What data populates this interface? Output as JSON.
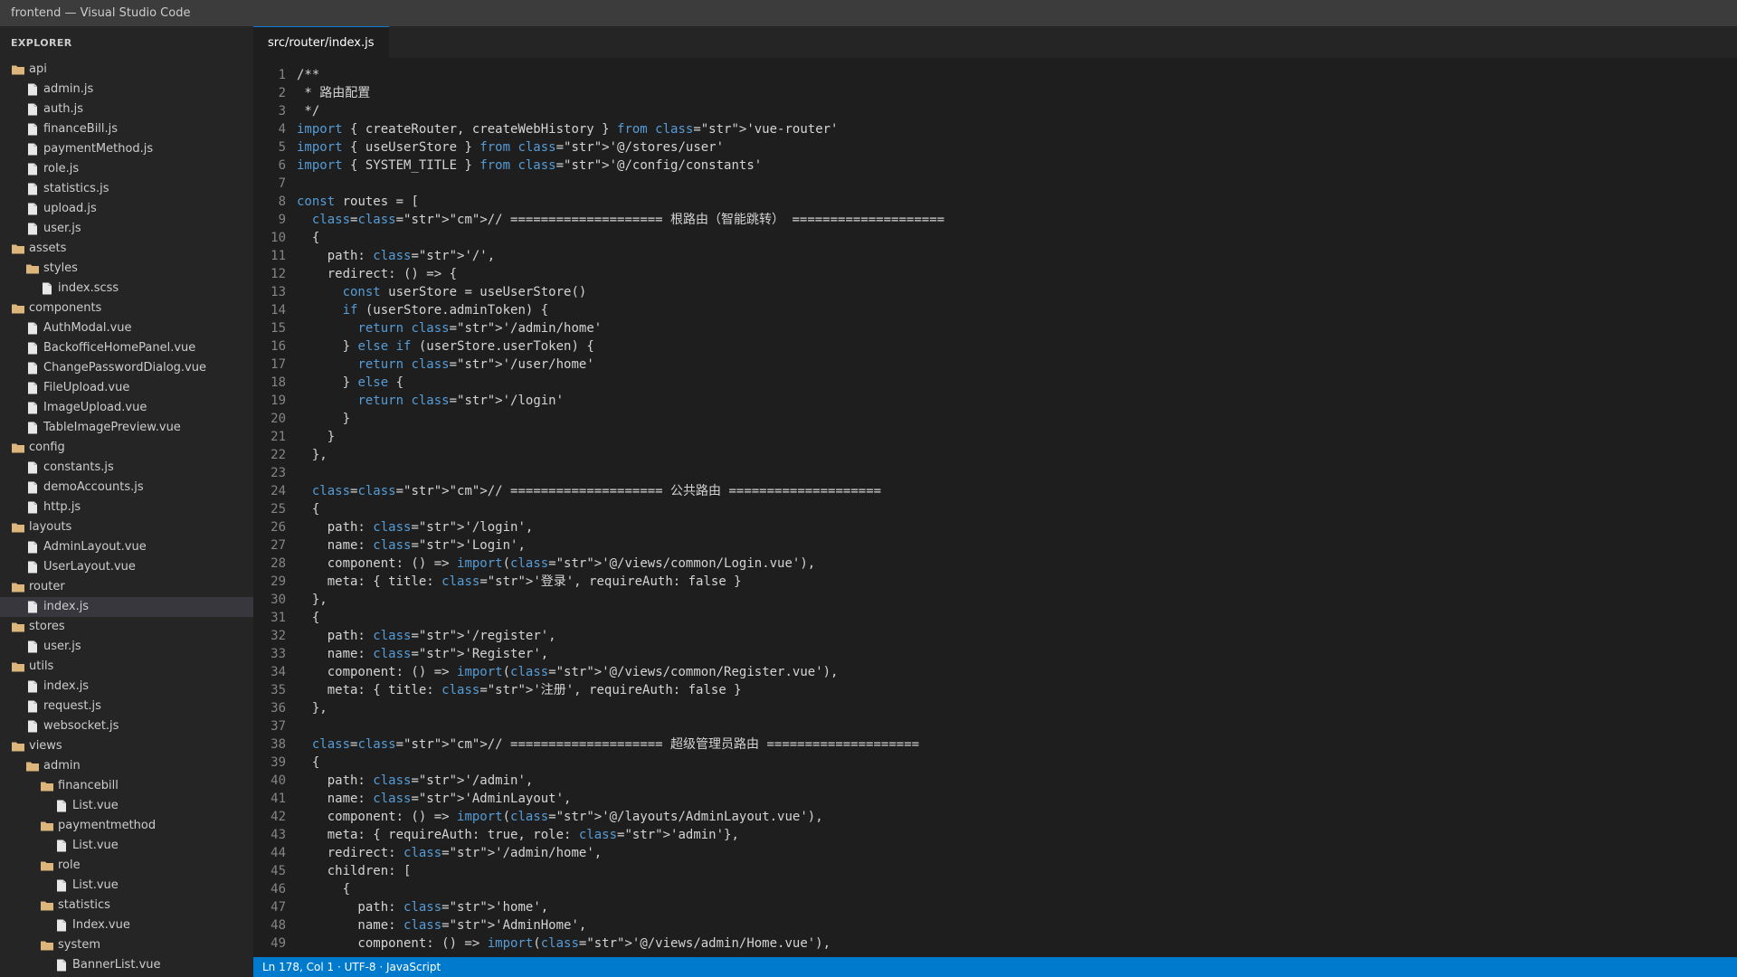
{
  "window": {
    "title": "frontend — Visual Studio Code"
  },
  "explorer": {
    "title": "EXPLORER",
    "items": [
      {
        "label": "api",
        "type": "folder",
        "depth": 0
      },
      {
        "label": "admin.js",
        "type": "file",
        "depth": 1
      },
      {
        "label": "auth.js",
        "type": "file",
        "depth": 1
      },
      {
        "label": "financeBill.js",
        "type": "file",
        "depth": 1
      },
      {
        "label": "paymentMethod.js",
        "type": "file",
        "depth": 1
      },
      {
        "label": "role.js",
        "type": "file",
        "depth": 1
      },
      {
        "label": "statistics.js",
        "type": "file",
        "depth": 1
      },
      {
        "label": "upload.js",
        "type": "file",
        "depth": 1
      },
      {
        "label": "user.js",
        "type": "file",
        "depth": 1
      },
      {
        "label": "assets",
        "type": "folder",
        "depth": 0
      },
      {
        "label": "styles",
        "type": "folder",
        "depth": 1
      },
      {
        "label": "index.scss",
        "type": "file",
        "depth": 2
      },
      {
        "label": "components",
        "type": "folder",
        "depth": 0
      },
      {
        "label": "AuthModal.vue",
        "type": "file",
        "depth": 1
      },
      {
        "label": "BackofficeHomePanel.vue",
        "type": "file",
        "depth": 1
      },
      {
        "label": "ChangePasswordDialog.vue",
        "type": "file",
        "depth": 1
      },
      {
        "label": "FileUpload.vue",
        "type": "file",
        "depth": 1
      },
      {
        "label": "ImageUpload.vue",
        "type": "file",
        "depth": 1
      },
      {
        "label": "TableImagePreview.vue",
        "type": "file",
        "depth": 1
      },
      {
        "label": "config",
        "type": "folder",
        "depth": 0
      },
      {
        "label": "constants.js",
        "type": "file",
        "depth": 1
      },
      {
        "label": "demoAccounts.js",
        "type": "file",
        "depth": 1
      },
      {
        "label": "http.js",
        "type": "file",
        "depth": 1
      },
      {
        "label": "layouts",
        "type": "folder",
        "depth": 0
      },
      {
        "label": "AdminLayout.vue",
        "type": "file",
        "depth": 1
      },
      {
        "label": "UserLayout.vue",
        "type": "file",
        "depth": 1
      },
      {
        "label": "router",
        "type": "folder",
        "depth": 0
      },
      {
        "label": "index.js",
        "type": "file",
        "depth": 1,
        "active": true
      },
      {
        "label": "stores",
        "type": "folder",
        "depth": 0
      },
      {
        "label": "user.js",
        "type": "file",
        "depth": 1
      },
      {
        "label": "utils",
        "type": "folder",
        "depth": 0
      },
      {
        "label": "index.js",
        "type": "file",
        "depth": 1
      },
      {
        "label": "request.js",
        "type": "file",
        "depth": 1
      },
      {
        "label": "websocket.js",
        "type": "file",
        "depth": 1
      },
      {
        "label": "views",
        "type": "folder",
        "depth": 0
      },
      {
        "label": "admin",
        "type": "folder",
        "depth": 1
      },
      {
        "label": "financebill",
        "type": "folder",
        "depth": 2
      },
      {
        "label": "List.vue",
        "type": "file",
        "depth": 3
      },
      {
        "label": "paymentmethod",
        "type": "folder",
        "depth": 2
      },
      {
        "label": "List.vue",
        "type": "file",
        "depth": 3
      },
      {
        "label": "role",
        "type": "folder",
        "depth": 2
      },
      {
        "label": "List.vue",
        "type": "file",
        "depth": 3
      },
      {
        "label": "statistics",
        "type": "folder",
        "depth": 2
      },
      {
        "label": "Index.vue",
        "type": "file",
        "depth": 3
      },
      {
        "label": "system",
        "type": "folder",
        "depth": 2
      },
      {
        "label": "BannerList.vue",
        "type": "file",
        "depth": 3
      }
    ]
  },
  "editor": {
    "active_tab": "src/router/index.js",
    "lines": [
      {
        "n": "1",
        "segments": [
          {
            "t": "/**",
            "k": "plain"
          }
        ]
      },
      {
        "n": "2",
        "segments": [
          {
            "t": " * 路由配置",
            "k": "plain"
          }
        ]
      },
      {
        "n": "3",
        "segments": [
          {
            "t": " */",
            "k": "plain"
          }
        ]
      },
      {
        "n": "4",
        "segments": [
          {
            "t": "import",
            "k": "kw"
          },
          {
            "t": " { createRouter, createWebHistory } ",
            "k": "plain"
          },
          {
            "t": "from",
            "k": "kw"
          },
          {
            "t": " ",
            "k": "plain"
          },
          {
            "t": "class",
            "k": "kw"
          },
          {
            "t": "=\"str\">'vue-router'",
            "k": "plain"
          }
        ]
      },
      {
        "n": "5",
        "segments": [
          {
            "t": "import",
            "k": "kw"
          },
          {
            "t": " { useUserStore } ",
            "k": "plain"
          },
          {
            "t": "from",
            "k": "kw"
          },
          {
            "t": " ",
            "k": "plain"
          },
          {
            "t": "class",
            "k": "kw"
          },
          {
            "t": "=\"str\">'@/stores/user'",
            "k": "plain"
          }
        ]
      },
      {
        "n": "6",
        "segments": [
          {
            "t": "import",
            "k": "kw"
          },
          {
            "t": " { SYSTEM_TITLE } ",
            "k": "plain"
          },
          {
            "t": "from",
            "k": "kw"
          },
          {
            "t": " ",
            "k": "plain"
          },
          {
            "t": "class",
            "k": "kw"
          },
          {
            "t": "=\"str\">'@/config/constants'",
            "k": "plain"
          }
        ]
      },
      {
        "n": "7",
        "segments": [
          {
            "t": "",
            "k": "plain"
          }
        ]
      },
      {
        "n": "8",
        "segments": [
          {
            "t": "const",
            "k": "kw"
          },
          {
            "t": " routes = [",
            "k": "plain"
          }
        ]
      },
      {
        "n": "9",
        "segments": [
          {
            "t": "  ",
            "k": "plain"
          },
          {
            "t": "class",
            "k": "kw"
          },
          {
            "t": "=",
            "k": "plain"
          },
          {
            "t": "class",
            "k": "kw"
          },
          {
            "t": "=\"str\">\"cm\">// ==================== 根路由（智能跳转） ====================",
            "k": "plain"
          }
        ]
      },
      {
        "n": "10",
        "segments": [
          {
            "t": "  {",
            "k": "plain"
          }
        ]
      },
      {
        "n": "11",
        "segments": [
          {
            "t": "    path: ",
            "k": "plain"
          },
          {
            "t": "class",
            "k": "kw"
          },
          {
            "t": "=\"str\">'/',",
            "k": "plain"
          }
        ]
      },
      {
        "n": "12",
        "segments": [
          {
            "t": "    redirect: () => {",
            "k": "plain"
          }
        ]
      },
      {
        "n": "13",
        "segments": [
          {
            "t": "      ",
            "k": "plain"
          },
          {
            "t": "const",
            "k": "kw"
          },
          {
            "t": " userStore = useUserStore()",
            "k": "plain"
          }
        ]
      },
      {
        "n": "14",
        "segments": [
          {
            "t": "      ",
            "k": "plain"
          },
          {
            "t": "if",
            "k": "kw"
          },
          {
            "t": " (userStore.adminToken) {",
            "k": "plain"
          }
        ]
      },
      {
        "n": "15",
        "segments": [
          {
            "t": "        ",
            "k": "plain"
          },
          {
            "t": "return",
            "k": "kw"
          },
          {
            "t": " ",
            "k": "plain"
          },
          {
            "t": "class",
            "k": "kw"
          },
          {
            "t": "=\"str\">'/admin/home'",
            "k": "plain"
          }
        ]
      },
      {
        "n": "16",
        "segments": [
          {
            "t": "      } ",
            "k": "plain"
          },
          {
            "t": "else",
            "k": "kw"
          },
          {
            "t": " ",
            "k": "plain"
          },
          {
            "t": "if",
            "k": "kw"
          },
          {
            "t": " (userStore.userToken) {",
            "k": "plain"
          }
        ]
      },
      {
        "n": "17",
        "segments": [
          {
            "t": "        ",
            "k": "plain"
          },
          {
            "t": "return",
            "k": "kw"
          },
          {
            "t": " ",
            "k": "plain"
          },
          {
            "t": "class",
            "k": "kw"
          },
          {
            "t": "=\"str\">'/user/home'",
            "k": "plain"
          }
        ]
      },
      {
        "n": "18",
        "segments": [
          {
            "t": "      } ",
            "k": "plain"
          },
          {
            "t": "else",
            "k": "kw"
          },
          {
            "t": " {",
            "k": "plain"
          }
        ]
      },
      {
        "n": "19",
        "segments": [
          {
            "t": "        ",
            "k": "plain"
          },
          {
            "t": "return",
            "k": "kw"
          },
          {
            "t": " ",
            "k": "plain"
          },
          {
            "t": "class",
            "k": "kw"
          },
          {
            "t": "=\"str\">'/login'",
            "k": "plain"
          }
        ]
      },
      {
        "n": "20",
        "segments": [
          {
            "t": "      }",
            "k": "plain"
          }
        ]
      },
      {
        "n": "21",
        "segments": [
          {
            "t": "    }",
            "k": "plain"
          }
        ]
      },
      {
        "n": "22",
        "segments": [
          {
            "t": "  },",
            "k": "plain"
          }
        ]
      },
      {
        "n": "23",
        "segments": [
          {
            "t": "",
            "k": "plain"
          }
        ]
      },
      {
        "n": "24",
        "segments": [
          {
            "t": "  ",
            "k": "plain"
          },
          {
            "t": "class",
            "k": "kw"
          },
          {
            "t": "=",
            "k": "plain"
          },
          {
            "t": "class",
            "k": "kw"
          },
          {
            "t": "=\"str\">\"cm\">// ==================== 公共路由 ====================",
            "k": "plain"
          }
        ]
      },
      {
        "n": "25",
        "segments": [
          {
            "t": "  {",
            "k": "plain"
          }
        ]
      },
      {
        "n": "26",
        "segments": [
          {
            "t": "    path: ",
            "k": "plain"
          },
          {
            "t": "class",
            "k": "kw"
          },
          {
            "t": "=\"str\">'/login',",
            "k": "plain"
          }
        ]
      },
      {
        "n": "27",
        "segments": [
          {
            "t": "    name: ",
            "k": "plain"
          },
          {
            "t": "class",
            "k": "kw"
          },
          {
            "t": "=\"str\">'Login',",
            "k": "plain"
          }
        ]
      },
      {
        "n": "28",
        "segments": [
          {
            "t": "    component: () => ",
            "k": "plain"
          },
          {
            "t": "import",
            "k": "kw"
          },
          {
            "t": "(",
            "k": "plain"
          },
          {
            "t": "class",
            "k": "kw"
          },
          {
            "t": "=\"str\">'@/views/common/Login.vue'),",
            "k": "plain"
          }
        ]
      },
      {
        "n": "29",
        "segments": [
          {
            "t": "    meta: { title: ",
            "k": "plain"
          },
          {
            "t": "class",
            "k": "kw"
          },
          {
            "t": "=\"str\">'登录', requireAuth: false }",
            "k": "plain"
          }
        ]
      },
      {
        "n": "30",
        "segments": [
          {
            "t": "  },",
            "k": "plain"
          }
        ]
      },
      {
        "n": "31",
        "segments": [
          {
            "t": "  {",
            "k": "plain"
          }
        ]
      },
      {
        "n": "32",
        "segments": [
          {
            "t": "    path: ",
            "k": "plain"
          },
          {
            "t": "class",
            "k": "kw"
          },
          {
            "t": "=\"str\">'/register',",
            "k": "plain"
          }
        ]
      },
      {
        "n": "33",
        "segments": [
          {
            "t": "    name: ",
            "k": "plain"
          },
          {
            "t": "class",
            "k": "kw"
          },
          {
            "t": "=\"str\">'Register',",
            "k": "plain"
          }
        ]
      },
      {
        "n": "34",
        "segments": [
          {
            "t": "    component: () => ",
            "k": "plain"
          },
          {
            "t": "import",
            "k": "kw"
          },
          {
            "t": "(",
            "k": "plain"
          },
          {
            "t": "class",
            "k": "kw"
          },
          {
            "t": "=\"str\">'@/views/common/Register.vue'),",
            "k": "plain"
          }
        ]
      },
      {
        "n": "35",
        "segments": [
          {
            "t": "    meta: { title: ",
            "k": "plain"
          },
          {
            "t": "class",
            "k": "kw"
          },
          {
            "t": "=\"str\">'注册', requireAuth: false }",
            "k": "plain"
          }
        ]
      },
      {
        "n": "36",
        "segments": [
          {
            "t": "  },",
            "k": "plain"
          }
        ]
      },
      {
        "n": "37",
        "segments": [
          {
            "t": "",
            "k": "plain"
          }
        ]
      },
      {
        "n": "38",
        "segments": [
          {
            "t": "  ",
            "k": "plain"
          },
          {
            "t": "class",
            "k": "kw"
          },
          {
            "t": "=",
            "k": "plain"
          },
          {
            "t": "class",
            "k": "kw"
          },
          {
            "t": "=\"str\">\"cm\">// ==================== 超级管理员路由 ====================",
            "k": "plain"
          }
        ]
      },
      {
        "n": "39",
        "segments": [
          {
            "t": "  {",
            "k": "plain"
          }
        ]
      },
      {
        "n": "40",
        "segments": [
          {
            "t": "    path: ",
            "k": "plain"
          },
          {
            "t": "class",
            "k": "kw"
          },
          {
            "t": "=\"str\">'/admin',",
            "k": "plain"
          }
        ]
      },
      {
        "n": "41",
        "segments": [
          {
            "t": "    name: ",
            "k": "plain"
          },
          {
            "t": "class",
            "k": "kw"
          },
          {
            "t": "=\"str\">'AdminLayout',",
            "k": "plain"
          }
        ]
      },
      {
        "n": "42",
        "segments": [
          {
            "t": "    component: () => ",
            "k": "plain"
          },
          {
            "t": "import",
            "k": "kw"
          },
          {
            "t": "(",
            "k": "plain"
          },
          {
            "t": "class",
            "k": "kw"
          },
          {
            "t": "=\"str\">'@/layouts/AdminLayout.vue'),",
            "k": "plain"
          }
        ]
      },
      {
        "n": "43",
        "segments": [
          {
            "t": "    meta: { requireAuth: true, role: ",
            "k": "plain"
          },
          {
            "t": "class",
            "k": "kw"
          },
          {
            "t": "=\"str\">'admin'},",
            "k": "plain"
          }
        ]
      },
      {
        "n": "44",
        "segments": [
          {
            "t": "    redirect: ",
            "k": "plain"
          },
          {
            "t": "class",
            "k": "kw"
          },
          {
            "t": "=\"str\">'/admin/home',",
            "k": "plain"
          }
        ]
      },
      {
        "n": "45",
        "segments": [
          {
            "t": "    children: [",
            "k": "plain"
          }
        ]
      },
      {
        "n": "46",
        "segments": [
          {
            "t": "      {",
            "k": "plain"
          }
        ]
      },
      {
        "n": "47",
        "segments": [
          {
            "t": "        path: ",
            "k": "plain"
          },
          {
            "t": "class",
            "k": "kw"
          },
          {
            "t": "=\"str\">'home',",
            "k": "plain"
          }
        ]
      },
      {
        "n": "48",
        "segments": [
          {
            "t": "        name: ",
            "k": "plain"
          },
          {
            "t": "class",
            "k": "kw"
          },
          {
            "t": "=\"str\">'AdminHome',",
            "k": "plain"
          }
        ]
      },
      {
        "n": "49",
        "segments": [
          {
            "t": "        component: () => ",
            "k": "plain"
          },
          {
            "t": "import",
            "k": "kw"
          },
          {
            "t": "(",
            "k": "plain"
          },
          {
            "t": "class",
            "k": "kw"
          },
          {
            "t": "=\"str\">'@/views/admin/Home.vue'),",
            "k": "plain"
          }
        ]
      }
    ]
  },
  "statusbar": {
    "text": "Ln 178, Col 1 · UTF-8 · JavaScript"
  },
  "colors": {
    "keyword": "#569cd6",
    "plain": "#d4d4d4",
    "folder_icon": "#dcb67a",
    "file_icon": "#e8e8e8",
    "status_bg": "#007acc"
  }
}
